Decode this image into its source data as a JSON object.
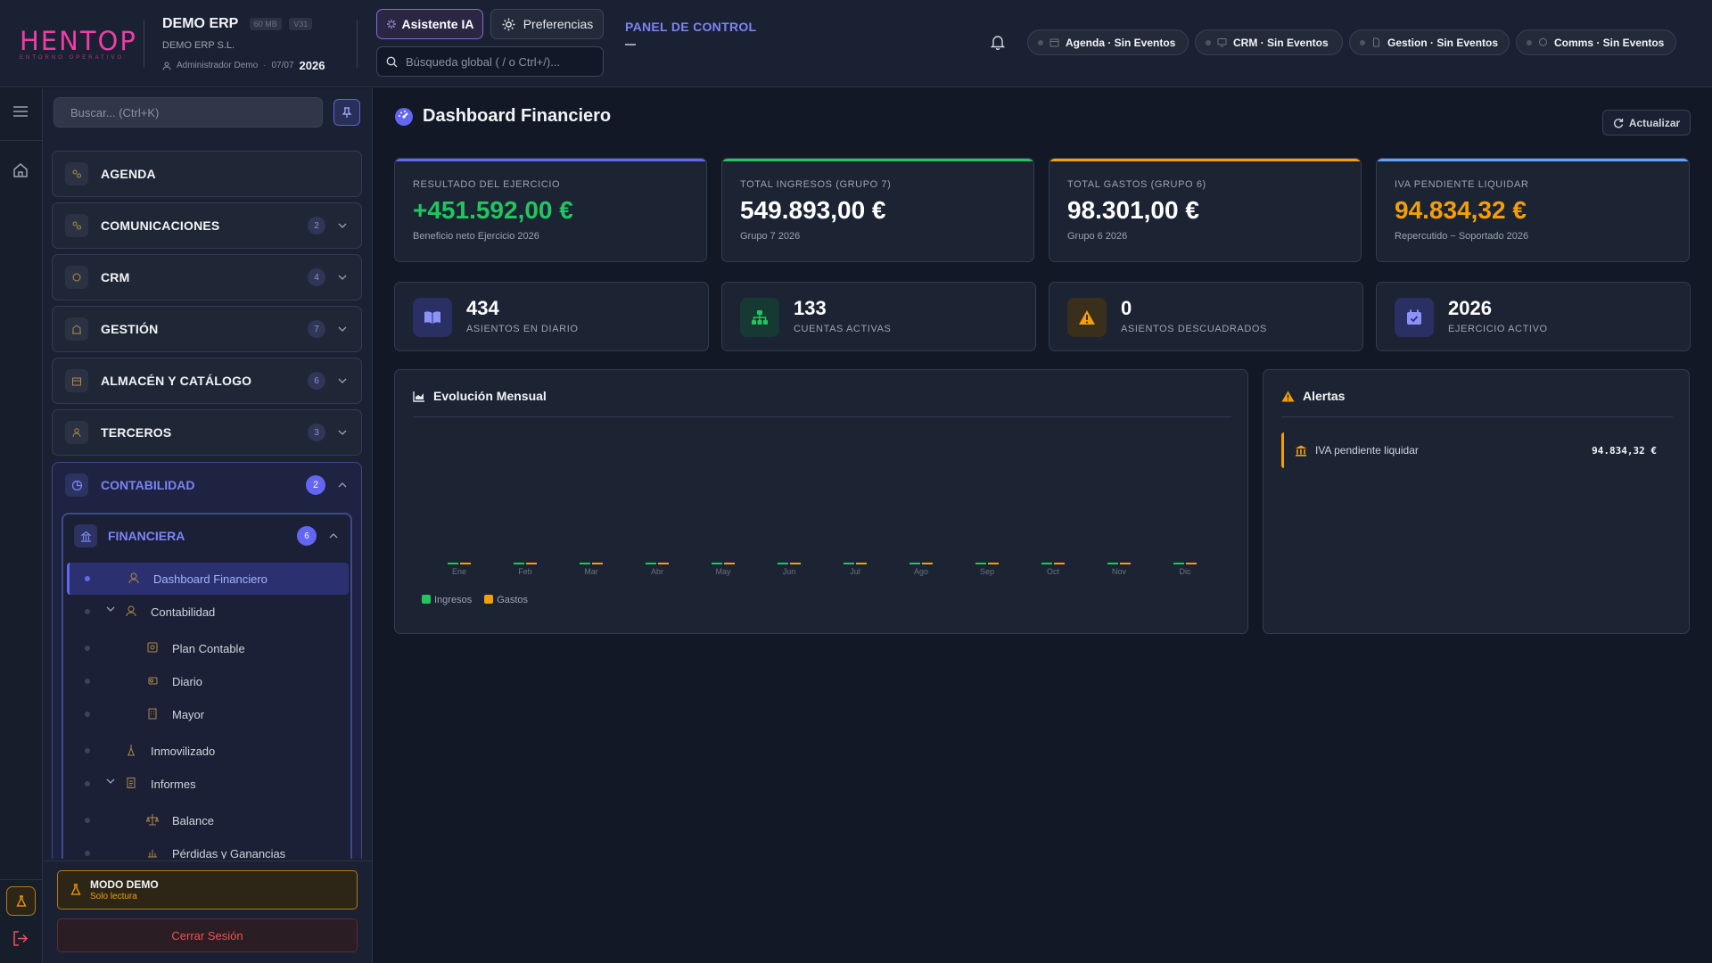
{
  "brand": {
    "logo": "HENTOP",
    "tagline": "ENTORNO OPERATIVO"
  },
  "company": {
    "name": "DEMO ERP",
    "storage": "60 MB",
    "version": "V31",
    "legal_name": "DEMO ERP S.L.",
    "user": "Administrador Demo",
    "date": "07/07",
    "year": "2026"
  },
  "header": {
    "ai_button": "Asistente IA",
    "prefs_button": "Preferencias",
    "search_placeholder": "Búsqueda global ( / o Ctrl+/)...",
    "panel_title": "PANEL DE CONTROL",
    "status_pills": [
      {
        "label": "Agenda · Sin Eventos",
        "icon": "calendar-icon"
      },
      {
        "label": "CRM · Sin Eventos",
        "icon": "monitor-icon"
      },
      {
        "label": "Gestion · Sin Eventos",
        "icon": "document-icon"
      },
      {
        "label": "Comms · Sin Eventos",
        "icon": "chat-icon"
      }
    ]
  },
  "sidebar": {
    "search_placeholder": "Buscar... (Ctrl+K)",
    "sections": [
      {
        "label": "AGENDA",
        "count": ""
      },
      {
        "label": "COMUNICACIONES",
        "count": "2"
      },
      {
        "label": "CRM",
        "count": "4"
      },
      {
        "label": "GESTIÓN",
        "count": "7"
      },
      {
        "label": "ALMACÉN Y CATÁLOGO",
        "count": "6"
      },
      {
        "label": "TERCEROS",
        "count": "3"
      }
    ],
    "accounting": {
      "label": "CONTABILIDAD",
      "count": "2",
      "financiera": {
        "label": "FINANCIERA",
        "count": "6",
        "items": [
          {
            "label": "Dashboard Financiero",
            "active": true
          },
          {
            "label": "Contabilidad"
          },
          {
            "label": "Plan Contable"
          },
          {
            "label": "Diario"
          },
          {
            "label": "Mayor"
          },
          {
            "label": "Inmovilizado"
          },
          {
            "label": "Informes"
          },
          {
            "label": "Balance"
          },
          {
            "label": "Pérdidas y Ganancias"
          }
        ]
      }
    },
    "demo": {
      "title": "MODO DEMO",
      "subtitle": "Solo lectura"
    },
    "logout": "Cerrar Sesión"
  },
  "main": {
    "title": "Dashboard Financiero",
    "refresh": "Actualizar",
    "kpis": [
      {
        "label": "RESULTADO DEL EJERCICIO",
        "value": "+451.592,00 €",
        "sub": "Beneficio neto Ejercicio 2026",
        "accent": "#6366f1",
        "value_color": "#22c55e"
      },
      {
        "label": "TOTAL INGRESOS (GRUPO 7)",
        "value": "549.893,00 €",
        "sub": "Grupo 7 2026",
        "accent": "#22c55e",
        "value_color": "#ffffff"
      },
      {
        "label": "TOTAL GASTOS (GRUPO 6)",
        "value": "98.301,00 €",
        "sub": "Grupo 6 2026",
        "accent": "#f59e0b",
        "value_color": "#ffffff"
      },
      {
        "label": "IVA PENDIENTE LIQUIDAR",
        "value": "94.834,32 €",
        "sub": "Repercutido − Soportado 2026",
        "accent": "#60a5fa",
        "value_color": "#f59e0b"
      }
    ],
    "stats": [
      {
        "value": "434",
        "label": "ASIENTOS EN DIARIO",
        "icon": "book-icon",
        "color": "#6366f1"
      },
      {
        "value": "133",
        "label": "CUENTAS ACTIVAS",
        "icon": "sitemap-icon",
        "color": "#22c55e"
      },
      {
        "value": "0",
        "label": "ASIENTOS DESCUADRADOS",
        "icon": "warning-icon",
        "color": "#f59e0b"
      },
      {
        "value": "2026",
        "label": "EJERCICIO ACTIVO",
        "icon": "calendar-check-icon",
        "color": "#6366f1"
      }
    ],
    "chart_title": "Evolución Mensual",
    "alerts_title": "Alertas",
    "alerts": [
      {
        "label": "IVA pendiente liquidar",
        "value": "94.834,32 €"
      }
    ]
  },
  "chart_data": {
    "type": "bar",
    "categories": [
      "Ene",
      "Feb",
      "Mar",
      "Abr",
      "May",
      "Jun",
      "Jul",
      "Ago",
      "Sep",
      "Oct",
      "Nov",
      "Dic"
    ],
    "series": [
      {
        "name": "Ingresos",
        "values": [
          0,
          0,
          0,
          0,
          0,
          0,
          0,
          0,
          0,
          0,
          0,
          0
        ],
        "color": "#22c55e"
      },
      {
        "name": "Gastos",
        "values": [
          0,
          0,
          0,
          0,
          0,
          0,
          0,
          0,
          0,
          0,
          0,
          0
        ],
        "color": "#f59e0b"
      }
    ],
    "title": "Evolución Mensual",
    "xlabel": "",
    "ylabel": "",
    "grid": false,
    "legend": "bottom-left"
  }
}
